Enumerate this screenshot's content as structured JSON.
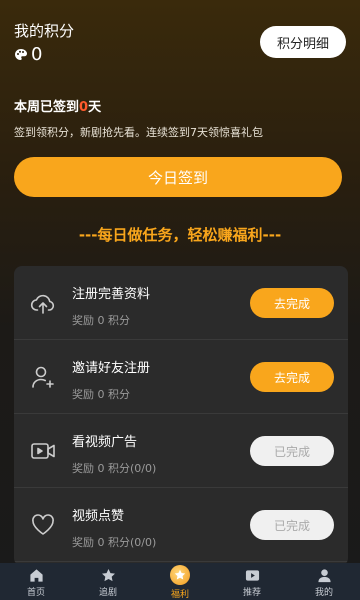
{
  "header": {
    "title": "我的积分",
    "points": "0",
    "detail_button": "积分明细",
    "week_prefix": "本周已签到",
    "week_count": "0",
    "week_suffix": "天",
    "description": "签到领积分，新剧抢先看。连续签到7天领惊喜礼包",
    "checkin_button": "今日签到"
  },
  "slogan": "---每日做任务，轻松赚福利---",
  "tasks": [
    {
      "name": "注册完善资料",
      "reward": "奖励 0 积分",
      "button": "去完成",
      "state": "active",
      "icon": "cloud-upload-icon"
    },
    {
      "name": "邀请好友注册",
      "reward": "奖励 0 积分",
      "button": "去完成",
      "state": "active",
      "icon": "add-user-icon"
    },
    {
      "name": "看视频广告",
      "reward": "奖励 0 积分(0/0)",
      "button": "已完成",
      "state": "done",
      "icon": "video-icon"
    },
    {
      "name": "视频点赞",
      "reward": "奖励 0 积分(0/0)",
      "button": "已完成",
      "state": "done",
      "icon": "heart-icon"
    }
  ],
  "tabbar": [
    {
      "label": "首页",
      "icon": "home-icon"
    },
    {
      "label": "追剧",
      "icon": "star-icon"
    },
    {
      "label": "福利",
      "icon": "coin-icon",
      "active": true
    },
    {
      "label": "推荐",
      "icon": "play-icon"
    },
    {
      "label": "我的",
      "icon": "person-icon"
    }
  ],
  "colors": {
    "accent": "#f9a61c",
    "highlight": "#ff5a2c",
    "card": "#2b2b2b",
    "tabbar": "#202833"
  }
}
